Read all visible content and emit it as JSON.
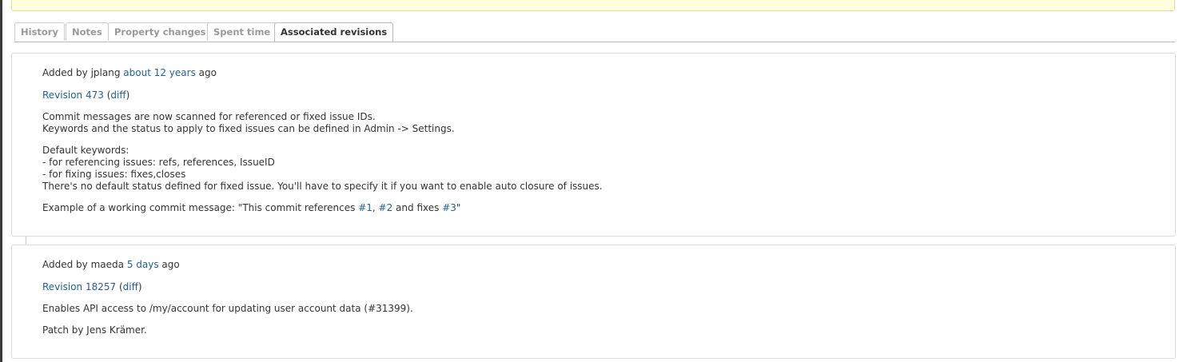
{
  "tabs": [
    {
      "label": "History"
    },
    {
      "label": "Notes"
    },
    {
      "label": "Property changes"
    },
    {
      "label": "Spent time"
    },
    {
      "label": "Associated revisions"
    }
  ],
  "revisions": [
    {
      "added_by_prefix": "Added by jplang",
      "time_link": "about 12 years",
      "ago": "ago",
      "revision_link": "Revision 473",
      "paren_open": "(",
      "diff_link": "diff",
      "paren_close": ")",
      "lines": [
        "Commit messages are now scanned for referenced or fixed issue IDs.",
        "Keywords and the status to apply to fixed issues can be defined in Admin -> Settings.",
        "Default keywords:",
        "- for referencing issues: refs, references, IssueID",
        "- for fixing issues: fixes,closes",
        "There's no default status defined for fixed issue. You'll have to specify it if you want to enable auto closure of issues."
      ],
      "example_prefix": "Example of a working commit message: \"This commit references ",
      "issue_1": "#1",
      "comma": ", ",
      "issue_2": "#2",
      "and_fixes": " and fixes ",
      "issue_3": "#3",
      "quote_end": "\""
    },
    {
      "added_by_prefix": "Added by maeda",
      "time_link": "5 days",
      "ago": "ago",
      "revision_link": "Revision 18257",
      "paren_open": "(",
      "diff_link": "diff",
      "paren_close": ")",
      "lines": [
        "Enables API access to /my/account for updating user account data (#31399).",
        "Patch by Jens Krämer."
      ]
    }
  ]
}
